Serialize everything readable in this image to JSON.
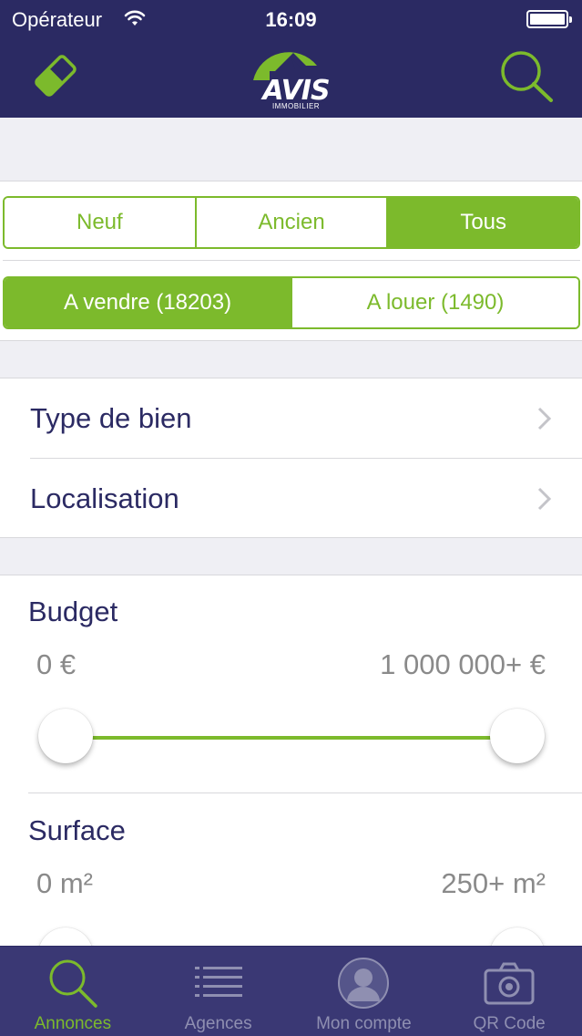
{
  "status_bar": {
    "carrier": "Opérateur",
    "time": "16:09"
  },
  "nav": {
    "logo_text": "AVIS",
    "logo_sub": "IMMOBILIER",
    "left_icon": "eraser-icon",
    "right_icon": "search-icon"
  },
  "segment_project": {
    "options": [
      "Neuf",
      "Ancien",
      "Tous"
    ],
    "selected": "Tous"
  },
  "segment_transaction": {
    "options": [
      "A vendre (18203)",
      "A louer (1490)"
    ],
    "selected": "A vendre (18203)"
  },
  "list": {
    "items": [
      {
        "label": "Type de bien"
      },
      {
        "label": "Localisation"
      }
    ]
  },
  "filters": {
    "budget": {
      "title": "Budget",
      "min_label": "0 €",
      "max_label": "1 000 000+ €",
      "range": [
        0,
        1
      ]
    },
    "surface": {
      "title": "Surface",
      "min_label": "0 m²",
      "max_label": "250+ m²",
      "range": [
        0,
        1
      ]
    }
  },
  "tabbar": {
    "items": [
      {
        "label": "Annonces",
        "icon": "search-icon",
        "active": true
      },
      {
        "label": "Agences",
        "icon": "list-icon",
        "active": false
      },
      {
        "label": "Mon compte",
        "icon": "user-icon",
        "active": false
      },
      {
        "label": "QR Code",
        "icon": "camera-icon",
        "active": false
      }
    ]
  },
  "colors": {
    "brand_navy": "#2b2a63",
    "accent_green": "#7cba2c",
    "tabbar_bg": "#3a3874"
  }
}
